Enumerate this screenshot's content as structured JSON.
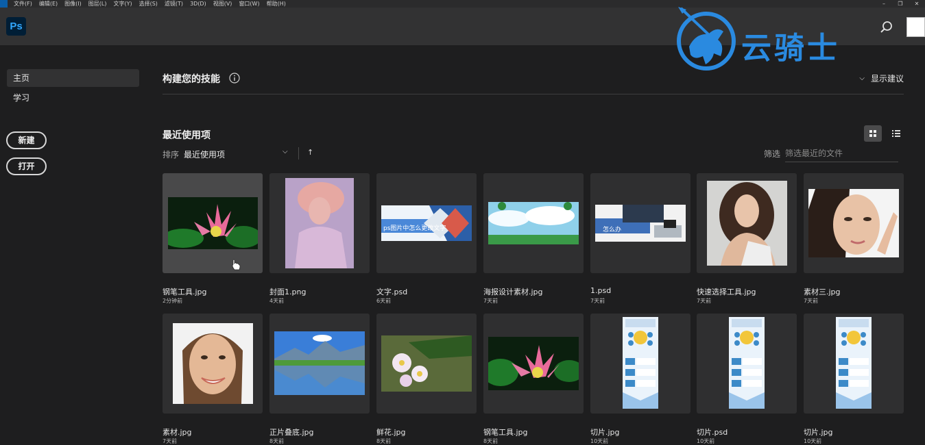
{
  "menubar": {
    "items": [
      "文件(F)",
      "编辑(E)",
      "图像(I)",
      "图层(L)",
      "文字(Y)",
      "选择(S)",
      "滤镜(T)",
      "3D(D)",
      "视图(V)",
      "窗口(W)",
      "帮助(H)"
    ]
  },
  "topbar": {
    "logo": "Ps"
  },
  "watermark": {
    "text": "云骑士"
  },
  "sidebar": {
    "home": "主页",
    "learn": "学习",
    "new_button": "新建",
    "open_button": "打开"
  },
  "skills": {
    "title": "构建您的技能",
    "show_tips": "显示建议"
  },
  "recent": {
    "title": "最近使用项",
    "sort_label": "排序",
    "sort_value": "最近使用项",
    "filter_label": "筛选",
    "filter_placeholder": "筛选最近的文件"
  },
  "files": [
    {
      "name": "钢笔工具.jpg",
      "time": "2分钟前",
      "thumb": "lotus-wide"
    },
    {
      "name": "封面1.png",
      "time": "4天前",
      "thumb": "portrait-pink"
    },
    {
      "name": "文字.psd",
      "time": "6天前",
      "thumb": "banner-text",
      "caption": "ps图片中怎么更改文字"
    },
    {
      "name": "海报设计素材.jpg",
      "time": "7天前",
      "thumb": "sky-banner"
    },
    {
      "name": "1.psd",
      "time": "7天前",
      "thumb": "desk-banner",
      "caption": "怎么办"
    },
    {
      "name": "快速选择工具.jpg",
      "time": "7天前",
      "thumb": "woman-curly"
    },
    {
      "name": "素材三.jpg",
      "time": "7天前",
      "thumb": "woman-face"
    },
    {
      "name": "素材.jpg",
      "time": "7天前",
      "thumb": "woman-smile"
    },
    {
      "name": "正片叠底.jpg",
      "time": "8天前",
      "thumb": "lake"
    },
    {
      "name": "鲜花.jpg",
      "time": "8天前",
      "thumb": "flowers"
    },
    {
      "name": "钢笔工具.jpg",
      "time": "8天前",
      "thumb": "lotus-wide2"
    },
    {
      "name": "切片.jpg",
      "time": "10天前",
      "thumb": "infographic"
    },
    {
      "name": "切片.psd",
      "time": "10天前",
      "thumb": "infographic"
    },
    {
      "name": "切片.jpg",
      "time": "10天前",
      "thumb": "infographic"
    }
  ],
  "colors": {
    "accent": "#31a8ff",
    "watermark": "#2a8ae0",
    "background": "#1e1e1f"
  }
}
